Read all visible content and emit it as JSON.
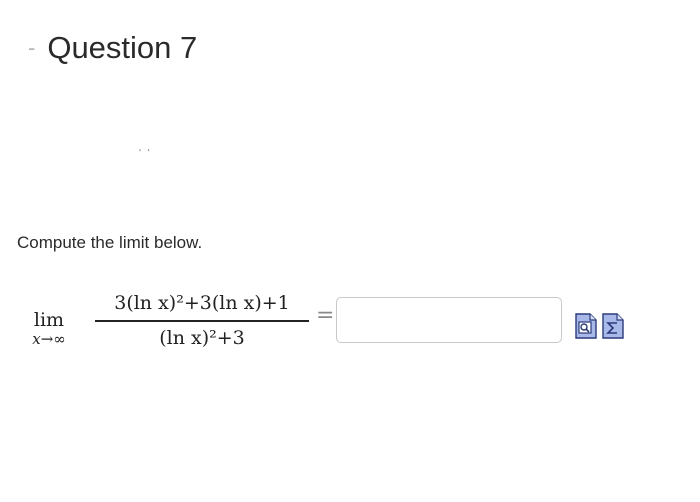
{
  "header": {
    "collapse_symbol": "-",
    "title": "Question 7"
  },
  "stray_mark": "' '",
  "prompt": "Compute the limit below.",
  "math": {
    "lim_word": "lim",
    "lim_subscript": "x→∞",
    "numerator": "3(ln x)²+3(ln x)+1",
    "denominator": "(ln x)²+3",
    "equals": "="
  },
  "answer": {
    "value": "",
    "placeholder": ""
  },
  "tools": {
    "preview_icon": "preview-magnifier-icon",
    "equation_icon": "equation-editor-sigma-icon",
    "icon_color": "#a8b8e8",
    "icon_border": "#2a3a7a"
  }
}
